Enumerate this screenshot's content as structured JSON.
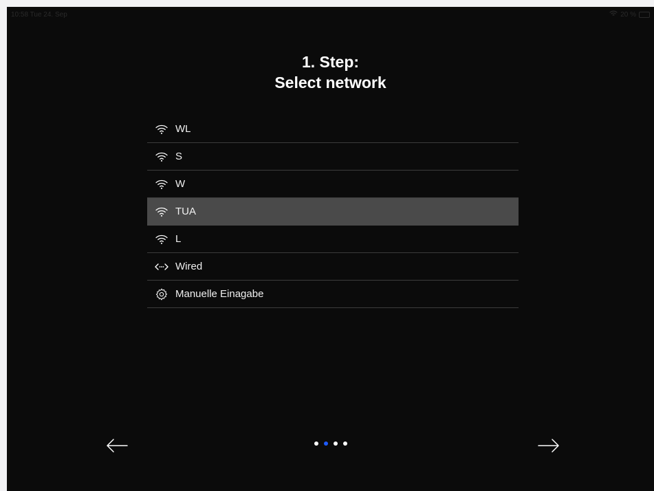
{
  "status_bar": {
    "time": "10:58",
    "date": "Tue 24. Sep",
    "battery": "20 %"
  },
  "title": {
    "line1": "1. Step:",
    "line2": "Select network"
  },
  "networks": [
    {
      "label": "WL",
      "icon": "wifi-icon",
      "selected": false
    },
    {
      "label": "S",
      "icon": "wifi-icon",
      "selected": false
    },
    {
      "label": "W",
      "icon": "wifi-icon",
      "selected": false
    },
    {
      "label": "TUA",
      "icon": "wifi-icon",
      "selected": true
    },
    {
      "label": "L",
      "icon": "wifi-icon",
      "selected": false
    },
    {
      "label": "Wired",
      "icon": "wired-icon",
      "selected": false
    },
    {
      "label": "Manuelle Einagabe",
      "icon": "gear-icon",
      "selected": false
    }
  ],
  "pagination": {
    "total": 4,
    "current": 2
  },
  "colors": {
    "background": "#0b0b0b",
    "selected_row": "#4a4a4a",
    "active_dot": "#1e5bff"
  }
}
